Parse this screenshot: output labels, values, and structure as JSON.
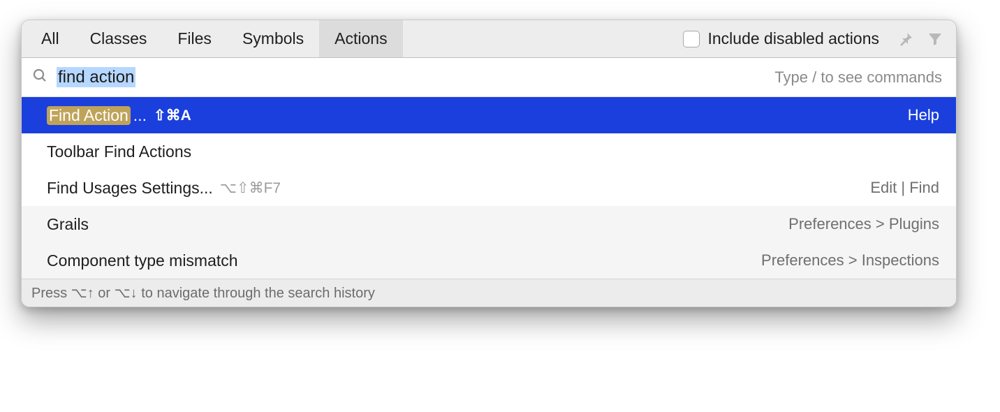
{
  "tabs": {
    "items": [
      "All",
      "Classes",
      "Files",
      "Symbols",
      "Actions"
    ],
    "active_index": 4
  },
  "checkbox_label": "Include disabled actions",
  "search": {
    "value": "find action",
    "hint": "Type / to see commands"
  },
  "results": [
    {
      "label_highlight": "Find Action",
      "label_rest": "...",
      "shortcut": "⇧⌘A",
      "origin": "Help",
      "selected": true,
      "alt": false
    },
    {
      "label": "Toolbar Find Actions",
      "shortcut": "",
      "origin": "",
      "selected": false,
      "alt": false
    },
    {
      "label": "Find Usages Settings...",
      "shortcut": "⌥⇧⌘F7",
      "origin": "Edit | Find",
      "selected": false,
      "alt": false
    },
    {
      "label": "Grails",
      "shortcut": "",
      "origin": "Preferences > Plugins",
      "selected": false,
      "alt": true
    },
    {
      "label": "Component type mismatch",
      "shortcut": "",
      "origin": "Preferences > Inspections",
      "selected": false,
      "alt": true
    }
  ],
  "footer": "Press ⌥↑ or ⌥↓ to navigate through the search history"
}
